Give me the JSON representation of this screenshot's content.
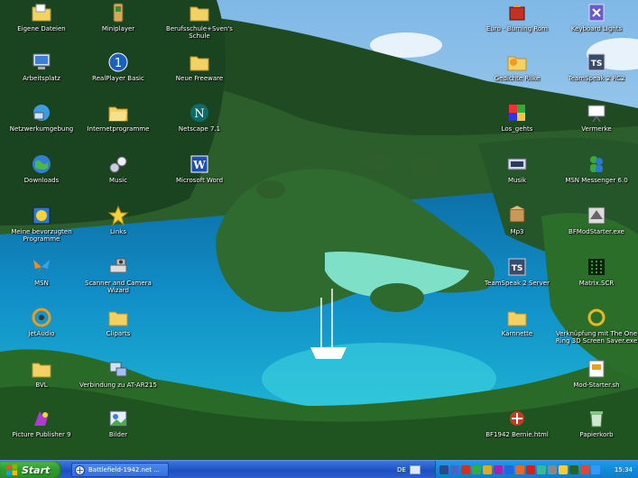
{
  "desktop": {
    "icons": [
      {
        "label": "Eigene Dateien",
        "icon": "folder-documents-icon"
      },
      {
        "label": "Miniplayer",
        "icon": "miniplayer-icon"
      },
      {
        "label": "Berufsschule+Sven's Schule",
        "icon": "folder-icon"
      },
      {
        "label": "Euro - Burning Rom",
        "icon": "burning-rom-icon"
      },
      {
        "label": "Keyboard Lights",
        "icon": "keyboard-lights-icon"
      },
      {
        "label": "Arbeitsplatz",
        "icon": "computer-icon"
      },
      {
        "label": "RealPlayer Basic",
        "icon": "realplayer-icon"
      },
      {
        "label": "Neue Freeware",
        "icon": "folder-icon"
      },
      {
        "label": "Gedichte Rilke",
        "icon": "folder-sun-icon"
      },
      {
        "label": "TeamSpeak 2 RC2",
        "icon": "teamspeak-icon"
      },
      {
        "label": "Netzwerkumgebung",
        "icon": "network-icon"
      },
      {
        "label": "Internetprogramme",
        "icon": "folder-open-icon"
      },
      {
        "label": "Netscape 7.1",
        "icon": "netscape-icon"
      },
      {
        "label": "Los_gehts",
        "icon": "cube-icon"
      },
      {
        "label": "Vermerke",
        "icon": "whiteboard-icon"
      },
      {
        "label": "Downloads",
        "icon": "globe-icon"
      },
      {
        "label": "Music",
        "icon": "music-icon"
      },
      {
        "label": "Microsoft Word",
        "icon": "word-icon"
      },
      {
        "label": "Musik",
        "icon": "musik-icon"
      },
      {
        "label": "MSN Messenger 6.0",
        "icon": "msn-messenger-icon"
      },
      {
        "label": "Meine bevorzugten Programme",
        "icon": "favorites-icon"
      },
      {
        "label": "Links",
        "icon": "star-icon"
      },
      {
        "label": "Mp3",
        "icon": "mp3-icon"
      },
      {
        "label": "BFModStarter.exe",
        "icon": "bfmodstarter-icon"
      },
      {
        "label": "MSN",
        "icon": "msn-butterfly-icon"
      },
      {
        "label": "Scanner and Camera Wizard",
        "icon": "scanner-camera-icon"
      },
      {
        "label": "TeamSpeak 2 Server",
        "icon": "teamspeak-server-icon"
      },
      {
        "label": "Matrix.SCR",
        "icon": "matrix-icon"
      },
      {
        "label": "jetAudio",
        "icon": "jetaudio-icon"
      },
      {
        "label": "Cliparts",
        "icon": "folder-icon"
      },
      {
        "label": "Kärnnette",
        "icon": "folder-icon"
      },
      {
        "label": "Verknüpfung mit The One Ring 3D Screen Saver.exe",
        "icon": "ring-screensaver-icon"
      },
      {
        "label": "BVL",
        "icon": "folder-icon"
      },
      {
        "label": "Verbindung zu AT-AR215",
        "icon": "connection-icon"
      },
      {
        "label": "Mod-Starter.sh",
        "icon": "mod-starter-icon"
      },
      {
        "label": "Picture Publisher 9",
        "icon": "picture-publisher-icon"
      },
      {
        "label": "Bilder",
        "icon": "bilder-icon"
      },
      {
        "label": "BF1942 Bernie.html",
        "icon": "bf1942-icon"
      },
      {
        "label": "Papierkorb",
        "icon": "recycle-bin-icon"
      }
    ]
  },
  "taskbar": {
    "start_label": "Start",
    "task_label": "Battlefield-1942.net ...",
    "language": "DE",
    "clock": "15:34",
    "tray_icon_colors": [
      "#2a4a8a",
      "#4466cc",
      "#cc3322",
      "#33aa44",
      "#ddaa22",
      "#aa22aa",
      "#2266dd",
      "#ee6622",
      "#cc2222",
      "#33bb99",
      "#888888",
      "#ffcc33",
      "#226622",
      "#dd4444",
      "#3399ff"
    ]
  },
  "colors": {
    "sky": "#a9d3f0",
    "lagoon": "#19b3d6",
    "taskbar": "#2458c8",
    "start": "#2f9a2c"
  }
}
